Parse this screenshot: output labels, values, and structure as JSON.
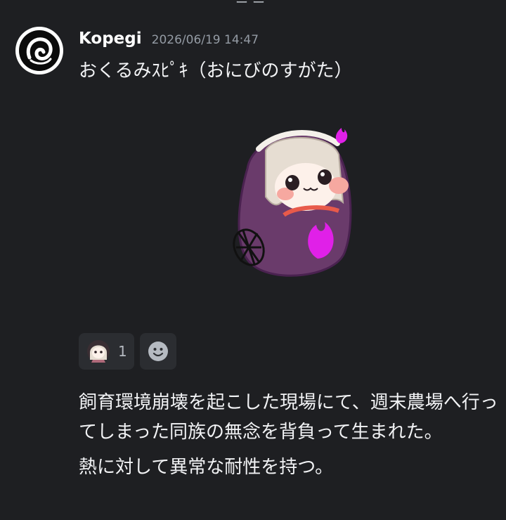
{
  "top_fragment": "ーー",
  "message": {
    "username": "Kopegi",
    "timestamp": "2026/06/19 14:47",
    "title": "おくるみｽﾋﾟｷ（おにびのすがた）",
    "avatar_icon": "swirl-logo-icon",
    "sticker_icon": "swaddled-character-sticker",
    "reactions": [
      {
        "emoji_icon": "character-emoji-icon",
        "count": "1"
      }
    ],
    "add_reaction_icon": "smiley-add-reaction-icon",
    "body": [
      "飼育環境崩壊を起こした現場にて、週末農場へ行ってしまった同族の無念を背負って生まれた。",
      "熱に対して異常な耐性を持つ。"
    ]
  },
  "colors": {
    "background": "#1e1f22",
    "username": "#ffffff",
    "timestamp": "#949ba4",
    "reaction_bg": "#2b2d31",
    "sticker_purple": "#6a3b6b",
    "flame_magenta": "#e020e8"
  }
}
